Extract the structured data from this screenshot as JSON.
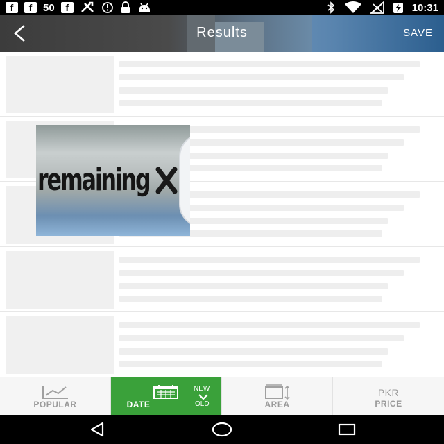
{
  "status_bar": {
    "notification_count": "50",
    "time": "10:31",
    "fb_glyph": "f",
    "icons": [
      "facebook-icon",
      "facebook-icon",
      "facebook-icon",
      "tools-icon",
      "data-saver-icon",
      "lock-icon",
      "android-icon",
      "bluetooth-icon",
      "wifi-icon",
      "signal-icon",
      "battery-charging-icon"
    ]
  },
  "app_bar": {
    "title": "Results",
    "save_label": "SAVE"
  },
  "list": {
    "placeholder_rows": 5
  },
  "ad_overlay": {
    "text": "remaining"
  },
  "sort_bar": {
    "tabs": [
      {
        "label": "POPULAR",
        "icon": "chart-icon"
      },
      {
        "label": "DATE",
        "icon": "calendar-icon",
        "order_top": "NEW",
        "order_bottom": "OLD"
      },
      {
        "label": "AREA",
        "icon": "area-icon"
      },
      {
        "label_top": "PKR",
        "label": "PRICE"
      }
    ],
    "active_color": "#3aa13a"
  },
  "nav_bar": {
    "icons": [
      "back-triangle-icon",
      "home-circle-icon",
      "recents-square-icon"
    ]
  }
}
